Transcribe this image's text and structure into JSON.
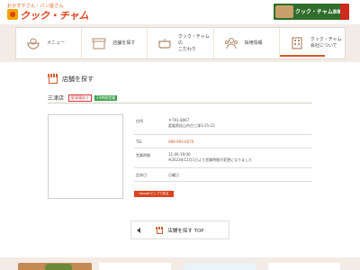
{
  "header": {
    "tagline": "おかずやさん・パン屋さん",
    "logo_text": "クック・チャム",
    "banner_text": "クック・チャムBB"
  },
  "nav": {
    "items": [
      {
        "label": "メニュー",
        "icon": "bowl-icon"
      },
      {
        "label": "店舗を探す",
        "icon": "store-icon"
      },
      {
        "label": "クック・チャムの\nこだわり",
        "icon": "pot-icon"
      },
      {
        "label": "採用情報",
        "icon": "people-icon"
      },
      {
        "label": "クック・チャム\n会社について",
        "icon": "building-icon"
      }
    ]
  },
  "page": {
    "title": "店舗を探す",
    "store_name": "三津店",
    "badge_red": "駐車場あり",
    "badge_green": "24時間営業"
  },
  "info": {
    "address_label": "住所",
    "address_value": "〒791-8067\n愛媛県松山市古三津3-25-23",
    "tel_label": "TEL",
    "tel_value": "089-993-6670",
    "hours_label": "営業時間",
    "hours_value": "11:00-19:00\n※2023年12月1日より営業時間が変更になりました",
    "closed_label": "定休日",
    "closed_value": "日曜日"
  },
  "buttons": {
    "map": "Googleマップで見る",
    "back": "店舗を探す TOP"
  },
  "colors": {
    "accent": "#d35a2a",
    "brand_red": "#e2401c",
    "badge_green": "#3aa14a",
    "nav_bg": "#f3ece6"
  }
}
